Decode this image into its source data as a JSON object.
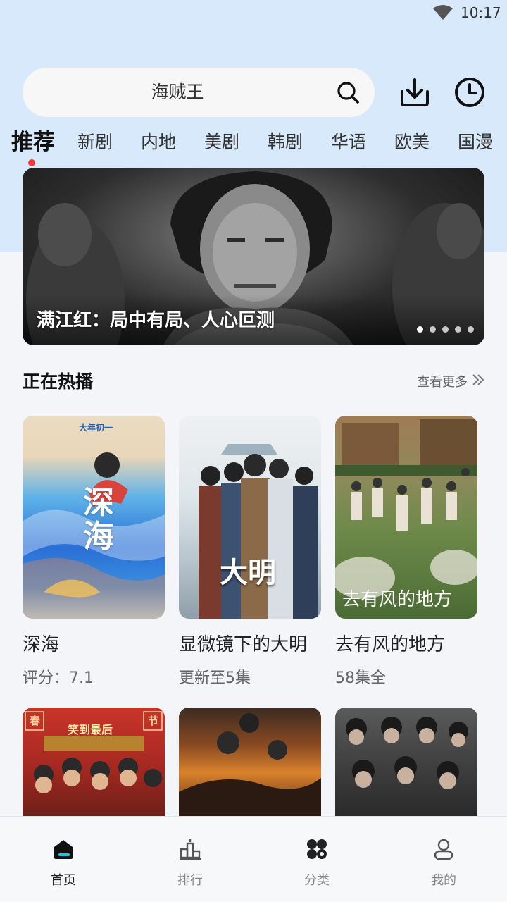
{
  "status_bar": {
    "time": "10:17",
    "wifi_icon": "wifi-icon"
  },
  "search": {
    "value": "海贼王",
    "icon": "search-icon"
  },
  "header_icons": [
    "download-icon",
    "history-icon"
  ],
  "tabs": [
    {
      "label": "推荐",
      "active": true
    },
    {
      "label": "新剧"
    },
    {
      "label": "内地"
    },
    {
      "label": "美剧"
    },
    {
      "label": "韩剧"
    },
    {
      "label": "华语"
    },
    {
      "label": "欧美"
    },
    {
      "label": "国漫"
    }
  ],
  "banner": {
    "title": "满江红：局中有局、人心叵测",
    "slide_count": 5,
    "active_slide": 1
  },
  "section": {
    "title": "正在热播",
    "more": "查看更多"
  },
  "cards": [
    {
      "title": "深海",
      "sub": "评分：7.1",
      "poster_text": "深海",
      "poster_top": "大年初一"
    },
    {
      "title": "显微镜下的大明",
      "sub": "更新至5集",
      "poster_text": "大明",
      "poster_top": ""
    },
    {
      "title": "去有风的地方",
      "sub": "58集全",
      "poster_text": "去有风的地方",
      "poster_top": ""
    },
    {
      "title": "",
      "sub": "",
      "poster_text": "",
      "poster_top": "笑到最后",
      "poster_corner_left": "春",
      "poster_corner_right": "节"
    },
    {
      "title": "",
      "sub": "",
      "poster_text": "",
      "poster_top": ""
    },
    {
      "title": "",
      "sub": "",
      "poster_text": "",
      "poster_top": ""
    }
  ],
  "bottom_nav": [
    {
      "label": "首页",
      "icon": "home-icon",
      "active": true
    },
    {
      "label": "排行",
      "icon": "ranking-icon"
    },
    {
      "label": "分类",
      "icon": "category-icon"
    },
    {
      "label": "我的",
      "icon": "profile-icon"
    }
  ],
  "colors": {
    "header_bg": "#d7e9fb",
    "page_bg": "#f3f5f9",
    "accent_dot": "#f23a3a",
    "home_accent": "#1fc5d6"
  }
}
